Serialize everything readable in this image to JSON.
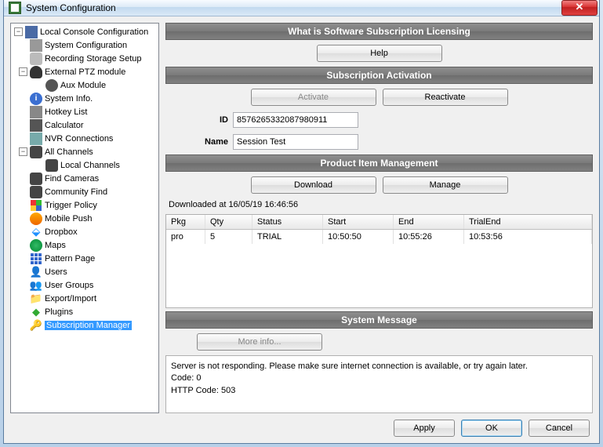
{
  "window": {
    "title": "System Configuration"
  },
  "tree": {
    "root": "Local Console Configuration",
    "items": {
      "sysconfig": "System Configuration",
      "recstore": "Recording Storage Setup",
      "ptz": "External PTZ module",
      "aux": "Aux Module",
      "sysinfo": "System Info.",
      "hotkey": "Hotkey List",
      "calc": "Calculator",
      "nvr": "NVR Connections",
      "allch": "All Channels",
      "localch": "Local Channels",
      "findcam": "Find Cameras",
      "commfind": "Community Find",
      "trigger": "Trigger Policy",
      "mobile": "Mobile Push",
      "dropbox": "Dropbox",
      "maps": "Maps",
      "pattern": "Pattern Page",
      "users": "Users",
      "groups": "User Groups",
      "expimp": "Export/Import",
      "plugins": "Plugins",
      "submgr": "Subscription Manager"
    }
  },
  "sections": {
    "what": "What is Software Subscription Licensing",
    "activation": "Subscription Activation",
    "product": "Product Item Management",
    "sysmsg": "System Message"
  },
  "buttons": {
    "help": "Help",
    "activate": "Activate",
    "reactivate": "Reactivate",
    "download": "Download",
    "manage": "Manage",
    "moreinfo": "More info...",
    "apply": "Apply",
    "ok": "OK",
    "cancel": "Cancel"
  },
  "form": {
    "id_label": "ID",
    "id_value": "8576265332087980911",
    "name_label": "Name",
    "name_value": "Session Test"
  },
  "download": {
    "label": "Downloaded at 16/05/19 16:46:56"
  },
  "table": {
    "headers": {
      "pkg": "Pkg",
      "qty": "Qty",
      "status": "Status",
      "start": "Start",
      "end": "End",
      "trial": "TrialEnd"
    },
    "rows": [
      {
        "pkg": "pro",
        "qty": "5",
        "status": "TRIAL",
        "start": "10:50:50",
        "end": "10:55:26",
        "trial": "10:53:56"
      }
    ]
  },
  "message": {
    "line1": "Server is not responding. Please make sure internet connection is available, or try again later.",
    "line2": "Code: 0",
    "line3": "HTTP Code: 503"
  }
}
